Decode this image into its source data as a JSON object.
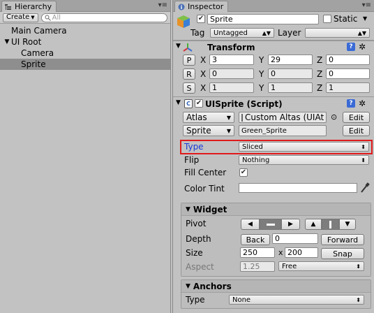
{
  "colors": {
    "selection": "#8e8e8e",
    "highlight_border": "#e01b1b",
    "type_label": "#1a3bd8"
  },
  "hierarchy": {
    "tab_label": "Hierarchy",
    "create_label": "Create",
    "search_placeholder": "All",
    "items": [
      {
        "label": "Main Camera",
        "depth": 0
      },
      {
        "label": "UI Root",
        "depth": 0,
        "expanded": true
      },
      {
        "label": "Camera",
        "depth": 1
      },
      {
        "label": "Sprite",
        "depth": 1,
        "selected": true
      }
    ]
  },
  "inspector": {
    "tab_label": "Inspector",
    "object_name": "Sprite",
    "static_label": "Static",
    "tag_label": "Tag",
    "tag_value": "Untagged",
    "layer_label": "Layer",
    "layer_value": "",
    "transform": {
      "title": "Transform",
      "rows": [
        {
          "btn": "P",
          "x": "3",
          "y": "29",
          "z": "0"
        },
        {
          "btn": "R",
          "x": "0",
          "y": "0",
          "z": "0"
        },
        {
          "btn": "S",
          "x": "1",
          "y": "1",
          "z": "1"
        }
      ],
      "x_label": "X",
      "y_label": "Y",
      "z_label": "Z"
    },
    "uisprite": {
      "title": "UISprite (Script)",
      "atlas_label": "Atlas",
      "atlas_value": "Custom Altas (UIAt",
      "sprite_label": "Sprite",
      "sprite_value": "Green_Sprite",
      "edit_label": "Edit",
      "type_label": "Type",
      "type_value": "Sliced",
      "flip_label": "Flip",
      "flip_value": "Nothing",
      "fill_center_label": "Fill Center",
      "color_tint_label": "Color Tint"
    },
    "widget": {
      "title": "Widget",
      "pivot_label": "Pivot",
      "depth_label": "Depth",
      "back_label": "Back",
      "depth_value": "0",
      "forward_label": "Forward",
      "size_label": "Size",
      "width": "250",
      "x_sep": "x",
      "height": "200",
      "snap_label": "Snap",
      "aspect_label": "Aspect",
      "aspect_value": "1.25",
      "aspect_mode": "Free"
    },
    "anchors": {
      "title": "Anchors",
      "type_label": "Type",
      "type_value": "None"
    }
  }
}
